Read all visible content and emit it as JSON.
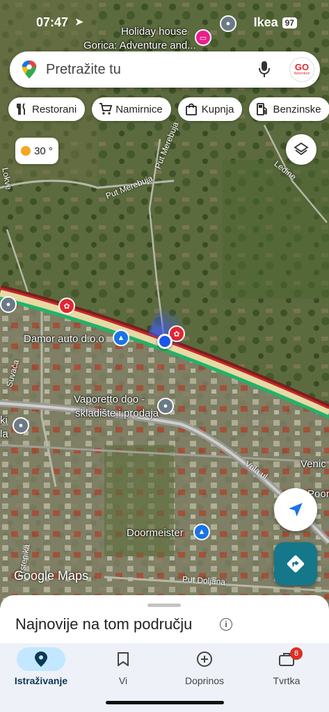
{
  "status": {
    "time": "07:47",
    "carrier": "Ikea",
    "battery": "97"
  },
  "search": {
    "placeholder": "Pretražite tu"
  },
  "avatar": {
    "line1": "GO",
    "line2": "Adventure"
  },
  "chips": [
    {
      "label": "Restorani",
      "icon": "fork-knife-icon"
    },
    {
      "label": "Namirnice",
      "icon": "cart-icon"
    },
    {
      "label": "Kupnja",
      "icon": "shopping-bag-icon"
    },
    {
      "label": "Benzinske",
      "icon": "gas-pump-icon"
    }
  ],
  "weather": {
    "temp": "30 °",
    "icon": "sun-icon"
  },
  "map_labels": {
    "holiday": "Holiday house",
    "gorica": "Gorica: Adventure and...",
    "damor": "Damor auto d.o.o",
    "vaporetto1": "Vaporetto doo -",
    "vaporetto2": "skladište i prodaja",
    "doormeister": "Doormeister",
    "venic": "Venic",
    "poort": "Poort",
    "ki": "ki",
    "la": "la"
  },
  "road_labels": {
    "put_merebuja_1": "Put Merebuja",
    "put_merebuja_2": "Put Merebuja",
    "ledine": "Ledine",
    "suvaca": "Suvača",
    "vrila": "Vrila ul.",
    "trstenika": "Trstenika",
    "doljana": "Put Doljana",
    "lokve": "Lokve"
  },
  "attribution": "Google Maps",
  "sheet": {
    "title": "Najnovije na tom području"
  },
  "nav": [
    {
      "label": "Istraživanje",
      "icon": "explore-pin-icon",
      "active": true
    },
    {
      "label": "Vi",
      "icon": "bookmark-icon"
    },
    {
      "label": "Doprinos",
      "icon": "add-circle-icon"
    },
    {
      "label": "Tvrtka",
      "icon": "business-icon",
      "badge": "8"
    }
  ],
  "colors": {
    "accent": "#15778a",
    "active_nav": "#c2e7ff",
    "poi_blue": "#1a73e8",
    "poi_pink": "#e91e8c",
    "badge": "#d93025"
  }
}
